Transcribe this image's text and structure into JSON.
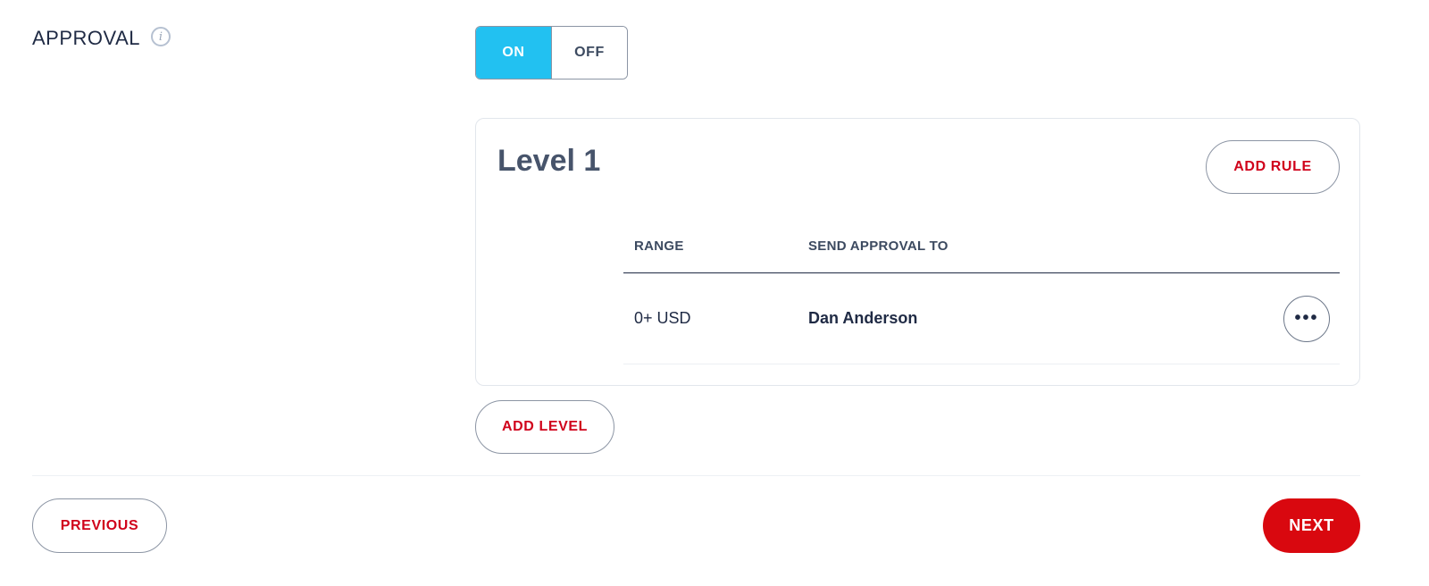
{
  "approval": {
    "label": "APPROVAL",
    "info_icon": "info-icon",
    "toggle": {
      "on_label": "ON",
      "off_label": "OFF",
      "selected": "ON"
    }
  },
  "level": {
    "title": "Level 1",
    "add_rule_label": "ADD RULE",
    "columns": {
      "range": "RANGE",
      "send_to": "SEND APPROVAL TO"
    },
    "rows": [
      {
        "range": "0+ USD",
        "send_to": "Dan Anderson",
        "more_icon": "more-horizontal-icon"
      }
    ]
  },
  "add_level_label": "ADD LEVEL",
  "footer": {
    "previous_label": "PREVIOUS",
    "next_label": "NEXT"
  },
  "colors": {
    "toggle_on": "#22c1f1",
    "accent_red": "#d9080f",
    "text_dark": "#1f2a44"
  }
}
